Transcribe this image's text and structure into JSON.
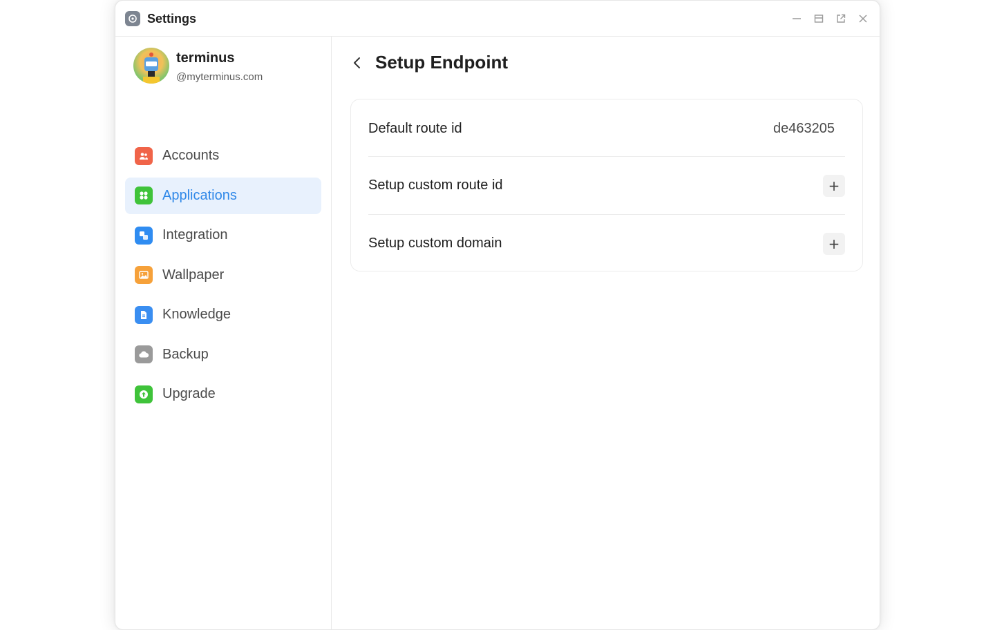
{
  "window": {
    "title": "Settings"
  },
  "profile": {
    "name": "terminus",
    "domain": "@myterminus.com"
  },
  "sidebar": {
    "items": [
      {
        "label": "Accounts",
        "icon": "accounts-icon",
        "color": "#f06449"
      },
      {
        "label": "Applications",
        "icon": "applications-icon",
        "color": "#3fc33a",
        "active": true
      },
      {
        "label": "Integration",
        "icon": "integration-icon",
        "color": "#2f8cf1"
      },
      {
        "label": "Wallpaper",
        "icon": "wallpaper-icon",
        "color": "#f6a13a"
      },
      {
        "label": "Knowledge",
        "icon": "knowledge-icon",
        "color": "#3a8ef1"
      },
      {
        "label": "Backup",
        "icon": "backup-icon",
        "color": "#9a9a9a"
      },
      {
        "label": "Upgrade",
        "icon": "upgrade-icon",
        "color": "#3fc33a"
      }
    ]
  },
  "main": {
    "title": "Setup Endpoint",
    "rows": [
      {
        "label": "Default route id",
        "value": "de463205"
      },
      {
        "label": "Setup custom route id",
        "action": "+"
      },
      {
        "label": "Setup custom domain",
        "action": "+"
      }
    ]
  },
  "colors": {
    "accent": "#2f88e8",
    "active_bg": "#e8f1fd"
  }
}
